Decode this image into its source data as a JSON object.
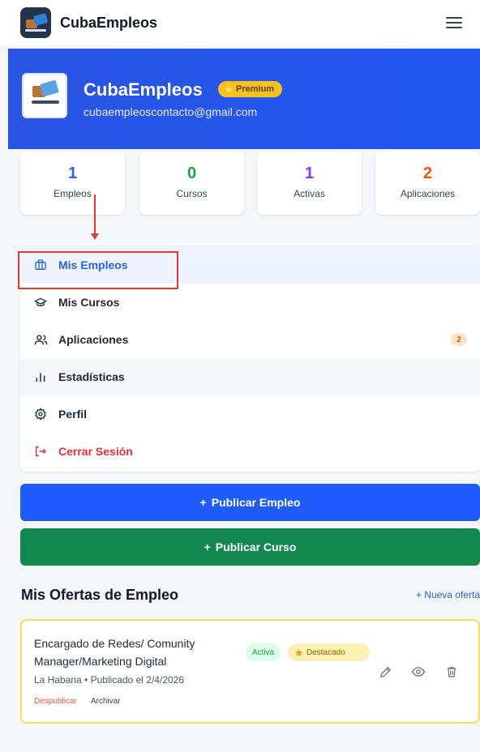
{
  "app": {
    "brand": "CubaEmpleos"
  },
  "profile": {
    "name": "CubaEmpleos",
    "badge": "Premium",
    "email": "cubaempleoscontacto@gmail.com"
  },
  "stats": [
    {
      "value": "1",
      "label": "Empleos",
      "color": "#2563eb"
    },
    {
      "value": "0",
      "label": "Cursos",
      "color": "#16a34a"
    },
    {
      "value": "1",
      "label": "Activas",
      "color": "#9333ea"
    },
    {
      "value": "2",
      "label": "Aplicaciones",
      "color": "#ea580c"
    }
  ],
  "menu": {
    "items": [
      {
        "label": "Mis Empleos",
        "icon": "briefcase-icon"
      },
      {
        "label": "Mis Cursos",
        "icon": "graduation-cap-icon"
      },
      {
        "label": "Aplicaciones",
        "icon": "users-icon",
        "count": "2"
      },
      {
        "label": "Estadísticas",
        "icon": "bar-chart-icon"
      },
      {
        "label": "Perfil",
        "icon": "gear-icon"
      },
      {
        "label": "Cerrar Sesión",
        "icon": "logout-icon"
      }
    ]
  },
  "actions": {
    "publish_job": "Publicar Empleo",
    "publish_course": "Publicar Curso"
  },
  "offers": {
    "title": "Mis Ofertas de Empleo",
    "new_link": "+ Nueva oferta",
    "items": [
      {
        "title": "Encargado de Redes/ Comunity Manager/Marketing Digital",
        "meta": "La Habana • Publicado el 2/4/2026",
        "status": "Activa",
        "featured": "Destacado",
        "unpublish": "Despublicar",
        "archive": "Archivar"
      }
    ]
  },
  "colors": {
    "primary": "#1f5cff",
    "success": "#12884e",
    "danger": "#e5303a",
    "premium": "#f9c11e"
  }
}
